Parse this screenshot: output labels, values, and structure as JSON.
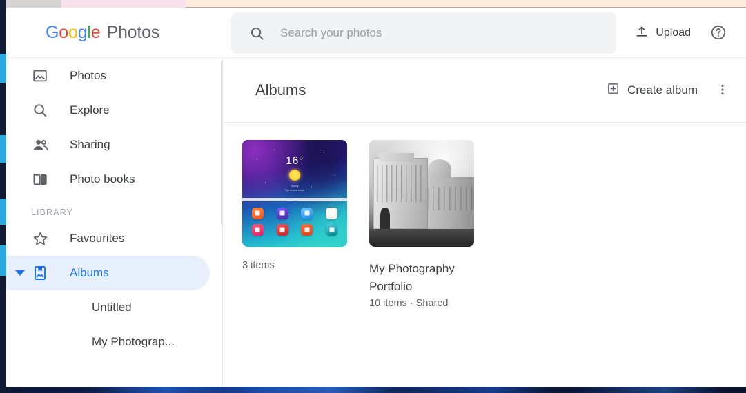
{
  "app": {
    "brand_google": "Google",
    "brand_product": "Photos",
    "brand_letters": [
      {
        "ch": "G",
        "color": "#4285f4"
      },
      {
        "ch": "o",
        "color": "#ea4335"
      },
      {
        "ch": "o",
        "color": "#fbbc05"
      },
      {
        "ch": "g",
        "color": "#4285f4"
      },
      {
        "ch": "l",
        "color": "#34a853"
      },
      {
        "ch": "e",
        "color": "#ea4335"
      }
    ]
  },
  "search": {
    "placeholder": "Search your photos",
    "value": ""
  },
  "header": {
    "upload_label": "Upload",
    "help_label": "?"
  },
  "sidebar": {
    "items": [
      {
        "label": "Photos",
        "icon": "photo-icon",
        "active": false
      },
      {
        "label": "Explore",
        "icon": "search-icon",
        "active": false
      },
      {
        "label": "Sharing",
        "icon": "people-icon",
        "active": false
      },
      {
        "label": "Photo books",
        "icon": "book-icon",
        "active": false
      }
    ],
    "library_label": "LIBRARY",
    "library_items": [
      {
        "label": "Favourites",
        "icon": "star-icon",
        "active": false
      },
      {
        "label": "Albums",
        "icon": "albums-icon",
        "active": true,
        "expanded": true
      }
    ],
    "album_children": [
      {
        "label": "Untitled",
        "thumb": "phone"
      },
      {
        "label": "My Photograp...",
        "thumb": "photo"
      }
    ]
  },
  "main": {
    "title": "Albums",
    "create_album_label": "Create album",
    "albums": [
      {
        "title": "",
        "meta": "3 items",
        "cover": "phone-screenshot",
        "cover_detail": {
          "temperature": "16°",
          "weather_line1": "Sunny",
          "weather_line2": "Tap to see more"
        }
      },
      {
        "title": "My Photography Portfolio",
        "meta": "10 items  ·  Shared",
        "cover": "pisa-cathedral"
      }
    ]
  },
  "colors": {
    "accent_blue": "#1a73e8",
    "active_pill": "#e8f0fe",
    "text_primary": "#3c4043",
    "text_secondary": "#5f6368",
    "search_bg": "#f1f3f4",
    "border": "#e8eaed"
  }
}
